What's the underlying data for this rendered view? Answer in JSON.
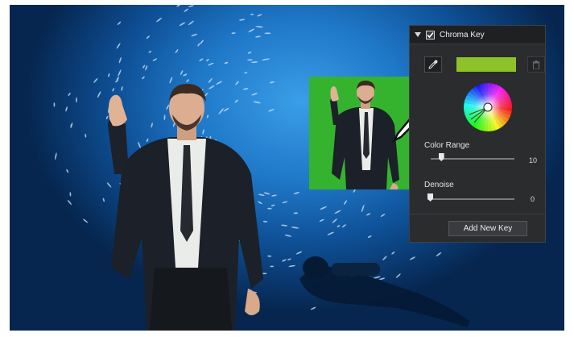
{
  "panel": {
    "title": "Chroma Key",
    "enabled": true,
    "key_color": "#8dc22a",
    "icons": {
      "collapse": "caret-down-icon",
      "checkbox": "checkbox-checked-icon",
      "eyedropper": "eyedropper-icon",
      "delete": "trash-icon",
      "wheel": "color-wheel-icon"
    },
    "color_range": {
      "label": "Color Range",
      "value": "10",
      "level": 0.1
    },
    "denoise": {
      "label": "Denoise",
      "value": "0",
      "level": 0.0
    },
    "add_key_label": "Add New Key"
  },
  "colors": {
    "panel_bg": "#2b2c2e",
    "green_screen": "#35b32f",
    "underwater": "#1f78c8"
  }
}
